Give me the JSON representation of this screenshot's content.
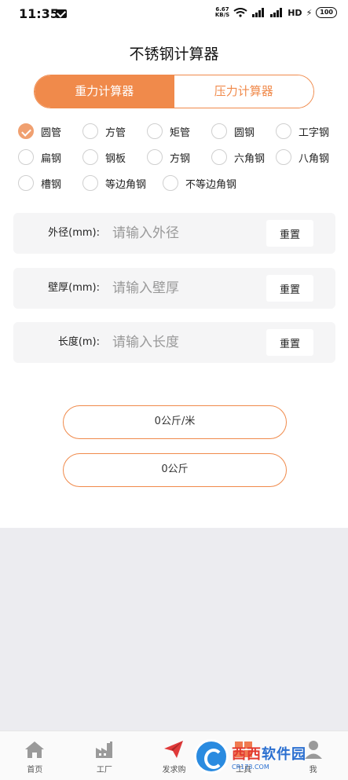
{
  "status": {
    "time": "11:35",
    "speed_value": "6.67",
    "speed_unit": "KB/S",
    "network": "HD",
    "battery": "100"
  },
  "title": "不锈钢计算器",
  "mode_tabs": [
    {
      "label": "重力计算器",
      "active": true
    },
    {
      "label": "压力计算器",
      "active": false
    }
  ],
  "material_options": [
    {
      "label": "圆管",
      "checked": true
    },
    {
      "label": "方管",
      "checked": false
    },
    {
      "label": "矩管",
      "checked": false
    },
    {
      "label": "圆钢",
      "checked": false
    },
    {
      "label": "工字钢",
      "checked": false
    },
    {
      "label": "扁钢",
      "checked": false
    },
    {
      "label": "钢板",
      "checked": false
    },
    {
      "label": "方钢",
      "checked": false
    },
    {
      "label": "六角钢",
      "checked": false
    },
    {
      "label": "八角钢",
      "checked": false
    },
    {
      "label": "槽钢",
      "checked": false
    },
    {
      "label": "等边角钢",
      "checked": false
    },
    {
      "label": "不等边角钢",
      "checked": false
    }
  ],
  "fields": [
    {
      "label": "外径(mm):",
      "placeholder": "请输入外径",
      "value": "",
      "reset_label": "重置"
    },
    {
      "label": "壁厚(mm):",
      "placeholder": "请输入壁厚",
      "value": "",
      "reset_label": "重置"
    },
    {
      "label": "长度(m):",
      "placeholder": "请输入长度",
      "value": "",
      "reset_label": "重置"
    }
  ],
  "results": {
    "per_meter": "0公斤/米",
    "total": "0公斤"
  },
  "tabbar": [
    {
      "label": "首页",
      "icon": "home-icon"
    },
    {
      "label": "工厂",
      "icon": "factory-icon"
    },
    {
      "label": "发求购",
      "icon": "paper-plane-icon"
    },
    {
      "label": "工具",
      "icon": "tools-icon"
    },
    {
      "label": "我",
      "icon": "user-icon"
    }
  ],
  "watermark": {
    "text_a": "西西",
    "text_b": "软件园",
    "sub": "CR173.COM"
  },
  "colors": {
    "accent": "#f08a4b",
    "checked": "#f0a070",
    "field_bg": "#f5f5f6",
    "page_bg": "#ececf0"
  }
}
